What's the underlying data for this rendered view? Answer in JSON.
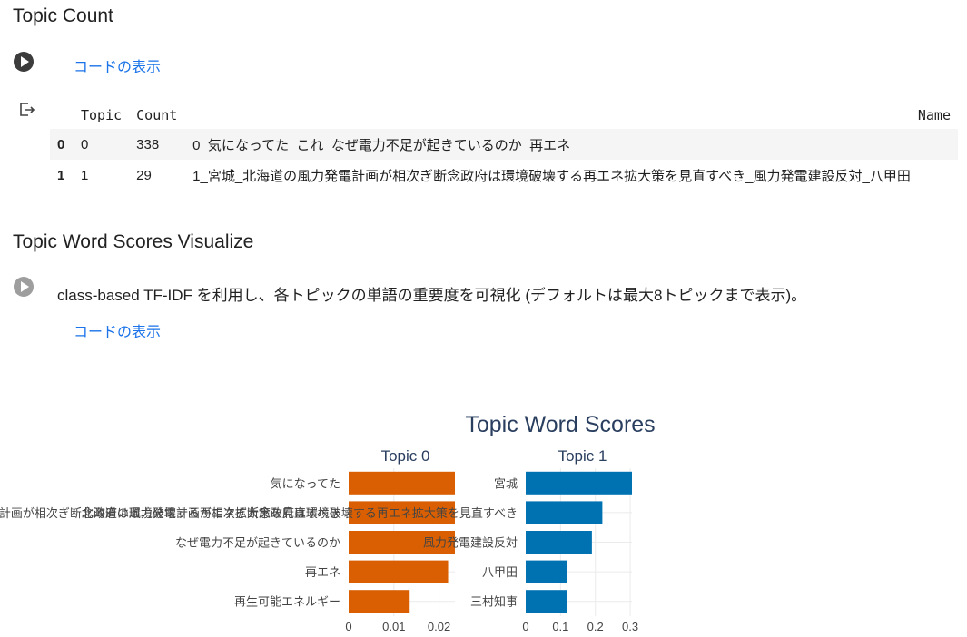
{
  "sections": {
    "topic_count": {
      "heading": "Topic Count",
      "show_code": "コードの表示"
    },
    "word_scores": {
      "heading": "Topic Word Scores Visualize",
      "description": "class-based TF-IDF を利用し、各トピックの単語の重要度を可視化 (デフォルトは最大8トピックまで表示)。",
      "show_code": "コードの表示"
    }
  },
  "table": {
    "columns": [
      "Topic",
      "Count",
      "Name"
    ],
    "rows": [
      {
        "index": "0",
        "topic": "0",
        "count": "338",
        "name": "0_気になってた_これ_なぜ電力不足が起きているのか_再エネ"
      },
      {
        "index": "1",
        "topic": "1",
        "count": "29",
        "name": "1_宮城_北海道の風力発電計画が相次ぎ断念政府は環境破壊する再エネ拡大策を見直すべき_風力発電建設反対_八甲田"
      }
    ]
  },
  "colors": {
    "topic0": "#d95f02",
    "topic1": "#0072b2",
    "link": "#1a73e8"
  },
  "icons": {
    "run": "play-circle-icon",
    "output": "output-arrow-icon"
  },
  "chart_data": {
    "type": "bar",
    "title": "Topic Word Scores",
    "orientation": "horizontal",
    "panels": [
      {
        "title": "Topic 0",
        "color": "#d95f02",
        "categories": [
          "気になってた",
          "北海道の風力発電計画が相次ぎ断念政府は環境破壊する再エネ拡大策を見直すべき",
          "なぜ電力不足が起きているのか",
          "再エネ",
          "再生可能エネルギー"
        ],
        "values": [
          0.0235,
          0.0235,
          0.0235,
          0.022,
          0.0135
        ],
        "xlim": [
          0,
          0.0235
        ],
        "ticks": [
          0,
          0.01,
          0.02
        ],
        "tick_labels": [
          "0",
          "0.01",
          "0.02"
        ]
      },
      {
        "title": "Topic 1",
        "color": "#0072b2",
        "categories": [
          "宮城",
          "北海道の風力発電計画が相次ぎ断念政府は環境破壊する再エネ拡大策を見直すべき",
          "風力発電建設反対",
          "八甲田",
          "三村知事"
        ],
        "values": [
          0.305,
          0.22,
          0.19,
          0.118,
          0.118
        ],
        "xlim": [
          0,
          0.305
        ],
        "ticks": [
          0,
          0.1,
          0.2,
          0.3
        ],
        "tick_labels": [
          "0",
          "0.1",
          "0.2",
          "0.3"
        ]
      }
    ],
    "grid": true,
    "legend": "none"
  }
}
